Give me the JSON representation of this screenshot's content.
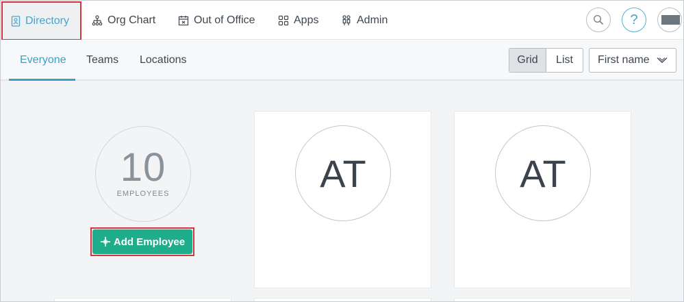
{
  "topnav": {
    "directory": "Directory",
    "org_chart": "Org Chart",
    "out_of_office": "Out of Office",
    "apps": "Apps",
    "admin": "Admin",
    "help": "?"
  },
  "subnav": {
    "tabs": [
      "Everyone",
      "Teams",
      "Locations"
    ],
    "view_grid": "Grid",
    "view_list": "List",
    "sort_value": "First name"
  },
  "summary": {
    "count": "10",
    "count_label": "EMPLOYEES",
    "add_button": "Add Employee"
  },
  "cards": [
    {
      "initials": "AT"
    },
    {
      "initials": "AT"
    }
  ],
  "colors": {
    "accent": "#4aa3c9",
    "add_button": "#1fae8c",
    "highlight": "#d6333a"
  }
}
